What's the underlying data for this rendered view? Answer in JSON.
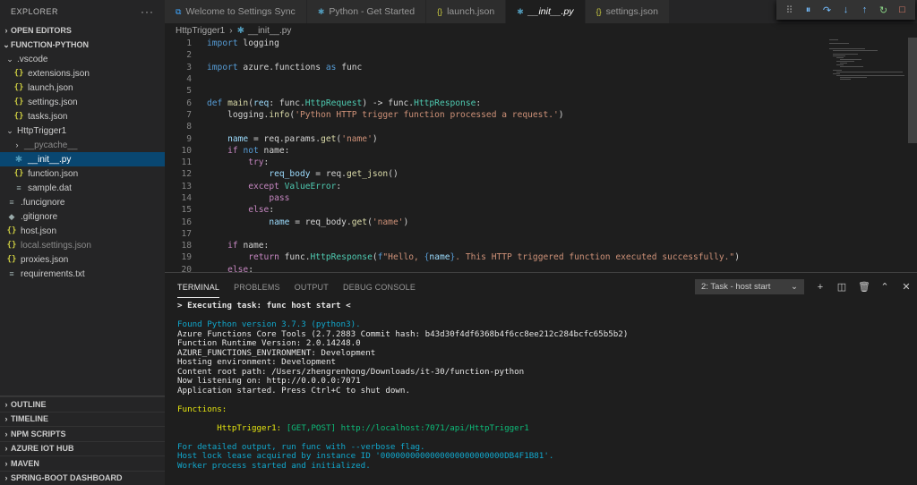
{
  "sidebar": {
    "title": "EXPLORER",
    "more_icon": "ellipsis-icon",
    "open_editors": "OPEN EDITORS",
    "project": "FUNCTION-PYTHON",
    "tree": [
      {
        "label": ".vscode",
        "type": "folder",
        "depth": 1,
        "open": true
      },
      {
        "label": "extensions.json",
        "type": "json",
        "depth": 2
      },
      {
        "label": "launch.json",
        "type": "json",
        "depth": 2
      },
      {
        "label": "settings.json",
        "type": "json",
        "depth": 2
      },
      {
        "label": "tasks.json",
        "type": "json",
        "depth": 2
      },
      {
        "label": "HttpTrigger1",
        "type": "folder",
        "depth": 1,
        "open": true
      },
      {
        "label": "__pycache__",
        "type": "folder",
        "depth": 2,
        "open": false,
        "dim": true
      },
      {
        "label": "__init__.py",
        "type": "py",
        "depth": 2,
        "selected": true
      },
      {
        "label": "function.json",
        "type": "json",
        "depth": 2
      },
      {
        "label": "sample.dat",
        "type": "file",
        "depth": 2
      },
      {
        "label": ".funcignore",
        "type": "file",
        "depth": 1
      },
      {
        "label": ".gitignore",
        "type": "git",
        "depth": 1
      },
      {
        "label": "host.json",
        "type": "json",
        "depth": 1
      },
      {
        "label": "local.settings.json",
        "type": "json",
        "depth": 1,
        "dim": true
      },
      {
        "label": "proxies.json",
        "type": "json",
        "depth": 1
      },
      {
        "label": "requirements.txt",
        "type": "file",
        "depth": 1
      }
    ],
    "bottom_sections": [
      "OUTLINE",
      "TIMELINE",
      "NPM SCRIPTS",
      "AZURE IOT HUB",
      "MAVEN",
      "SPRING-BOOT DASHBOARD"
    ]
  },
  "tabs": [
    {
      "label": "Welcome to Settings Sync",
      "icon": "vscode-icon"
    },
    {
      "label": "Python - Get Started",
      "icon": "python-icon"
    },
    {
      "label": "launch.json",
      "icon": "json-icon"
    },
    {
      "label": "__init__.py",
      "icon": "python-icon",
      "active": true
    },
    {
      "label": "settings.json",
      "icon": "json-icon"
    }
  ],
  "debug_toolbar": [
    "drag-handle-icon",
    "pause-icon",
    "step-over-icon",
    "step-into-icon",
    "step-out-icon",
    "restart-icon",
    "stop-icon"
  ],
  "breadcrumb": {
    "folder": "HttpTrigger1",
    "file": "__init__.py"
  },
  "code_lines": [
    [
      [
        "kw",
        "import"
      ],
      [
        "tx",
        " logging"
      ]
    ],
    [],
    [
      [
        "kw",
        "import"
      ],
      [
        "tx",
        " azure.functions "
      ],
      [
        "kw",
        "as"
      ],
      [
        "tx",
        " func"
      ]
    ],
    [],
    [],
    [
      [
        "kw",
        "def"
      ],
      [
        "tx",
        " "
      ],
      [
        "fn",
        "main"
      ],
      [
        "tx",
        "("
      ],
      [
        "vr",
        "req"
      ],
      [
        "tx",
        ": func."
      ],
      [
        "cls",
        "HttpRequest"
      ],
      [
        "tx",
        ") -> func."
      ],
      [
        "cls",
        "HttpResponse"
      ],
      [
        "tx",
        ":"
      ]
    ],
    [
      [
        "tx",
        "    logging."
      ],
      [
        "fn",
        "info"
      ],
      [
        "tx",
        "("
      ],
      [
        "str",
        "'Python HTTP trigger function processed a request.'"
      ],
      [
        "tx",
        ")"
      ]
    ],
    [],
    [
      [
        "tx",
        "    "
      ],
      [
        "vr",
        "name"
      ],
      [
        "tx",
        " = req.params."
      ],
      [
        "fn",
        "get"
      ],
      [
        "tx",
        "("
      ],
      [
        "str",
        "'name'"
      ],
      [
        "tx",
        ")"
      ]
    ],
    [
      [
        "tx",
        "    "
      ],
      [
        "ctl",
        "if"
      ],
      [
        "tx",
        " "
      ],
      [
        "kw",
        "not"
      ],
      [
        "tx",
        " name:"
      ]
    ],
    [
      [
        "tx",
        "        "
      ],
      [
        "ctl",
        "try"
      ],
      [
        "tx",
        ":"
      ]
    ],
    [
      [
        "tx",
        "            "
      ],
      [
        "vr",
        "req_body"
      ],
      [
        "tx",
        " = req."
      ],
      [
        "fn",
        "get_json"
      ],
      [
        "tx",
        "()"
      ]
    ],
    [
      [
        "tx",
        "        "
      ],
      [
        "ctl",
        "except"
      ],
      [
        "tx",
        " "
      ],
      [
        "cls",
        "ValueError"
      ],
      [
        "tx",
        ":"
      ]
    ],
    [
      [
        "tx",
        "            "
      ],
      [
        "ctl",
        "pass"
      ]
    ],
    [
      [
        "tx",
        "        "
      ],
      [
        "ctl",
        "else"
      ],
      [
        "tx",
        ":"
      ]
    ],
    [
      [
        "tx",
        "            "
      ],
      [
        "vr",
        "name"
      ],
      [
        "tx",
        " = req_body."
      ],
      [
        "fn",
        "get"
      ],
      [
        "tx",
        "("
      ],
      [
        "str",
        "'name'"
      ],
      [
        "tx",
        ")"
      ]
    ],
    [],
    [
      [
        "tx",
        "    "
      ],
      [
        "ctl",
        "if"
      ],
      [
        "tx",
        " name:"
      ]
    ],
    [
      [
        "tx",
        "        "
      ],
      [
        "ctl",
        "return"
      ],
      [
        "tx",
        " func."
      ],
      [
        "cls",
        "HttpResponse"
      ],
      [
        "tx",
        "("
      ],
      [
        "kw",
        "f"
      ],
      [
        "str",
        "\"Hello, "
      ],
      [
        "kw",
        "{"
      ],
      [
        "vr",
        "name"
      ],
      [
        "kw",
        "}"
      ],
      [
        "str",
        ". This HTTP triggered function executed successfully.\""
      ],
      [
        "tx",
        ")"
      ]
    ],
    [
      [
        "tx",
        "    "
      ],
      [
        "ctl",
        "else"
      ],
      [
        "tx",
        ":"
      ]
    ]
  ],
  "panel": {
    "tabs": [
      "TERMINAL",
      "PROBLEMS",
      "OUTPUT",
      "DEBUG CONSOLE"
    ],
    "task_select": "2: Task - host start",
    "controls": [
      "add-terminal-icon",
      "split-terminal-icon",
      "trash-icon",
      "maximize-panel-icon",
      "close-panel-icon"
    ]
  },
  "terminal_lines": [
    [
      [
        "tb",
        "> Executing task: func host start <"
      ]
    ],
    [],
    [
      [
        "tc",
        "Found Python version 3.7.3 (python3)."
      ]
    ],
    [
      [
        "tw",
        "Azure Functions Core Tools (2.7.2883 Commit hash: b43d30f4df6368b4f6cc8ee212c284bcfc65b5b2)"
      ]
    ],
    [
      [
        "tw",
        "Function Runtime Version: 2.0.14248.0"
      ]
    ],
    [
      [
        "tw",
        "AZURE_FUNCTIONS_ENVIRONMENT: Development"
      ]
    ],
    [
      [
        "tw",
        "Hosting environment: Development"
      ]
    ],
    [
      [
        "tw",
        "Content root path: /Users/zhengrenhong/Downloads/it-30/function-python"
      ]
    ],
    [
      [
        "tw",
        "Now listening on: http://0.0.0.0:7071"
      ]
    ],
    [
      [
        "tw",
        "Application started. Press Ctrl+C to shut down."
      ]
    ],
    [],
    [
      [
        "ty",
        "Functions:"
      ]
    ],
    [],
    [
      [
        "tw",
        "        "
      ],
      [
        "ty",
        "HttpTrigger1:"
      ],
      [
        "tg",
        " [GET,POST] http://localhost:7071/api/HttpTrigger1"
      ]
    ],
    [],
    [
      [
        "tc",
        "For detailed output, run func with --verbose flag."
      ]
    ],
    [
      [
        "tc",
        "Host lock lease acquired by instance ID '0000000000000000000000000DB4F1B81'."
      ]
    ],
    [
      [
        "tc",
        "Worker process started and initialized."
      ]
    ]
  ]
}
